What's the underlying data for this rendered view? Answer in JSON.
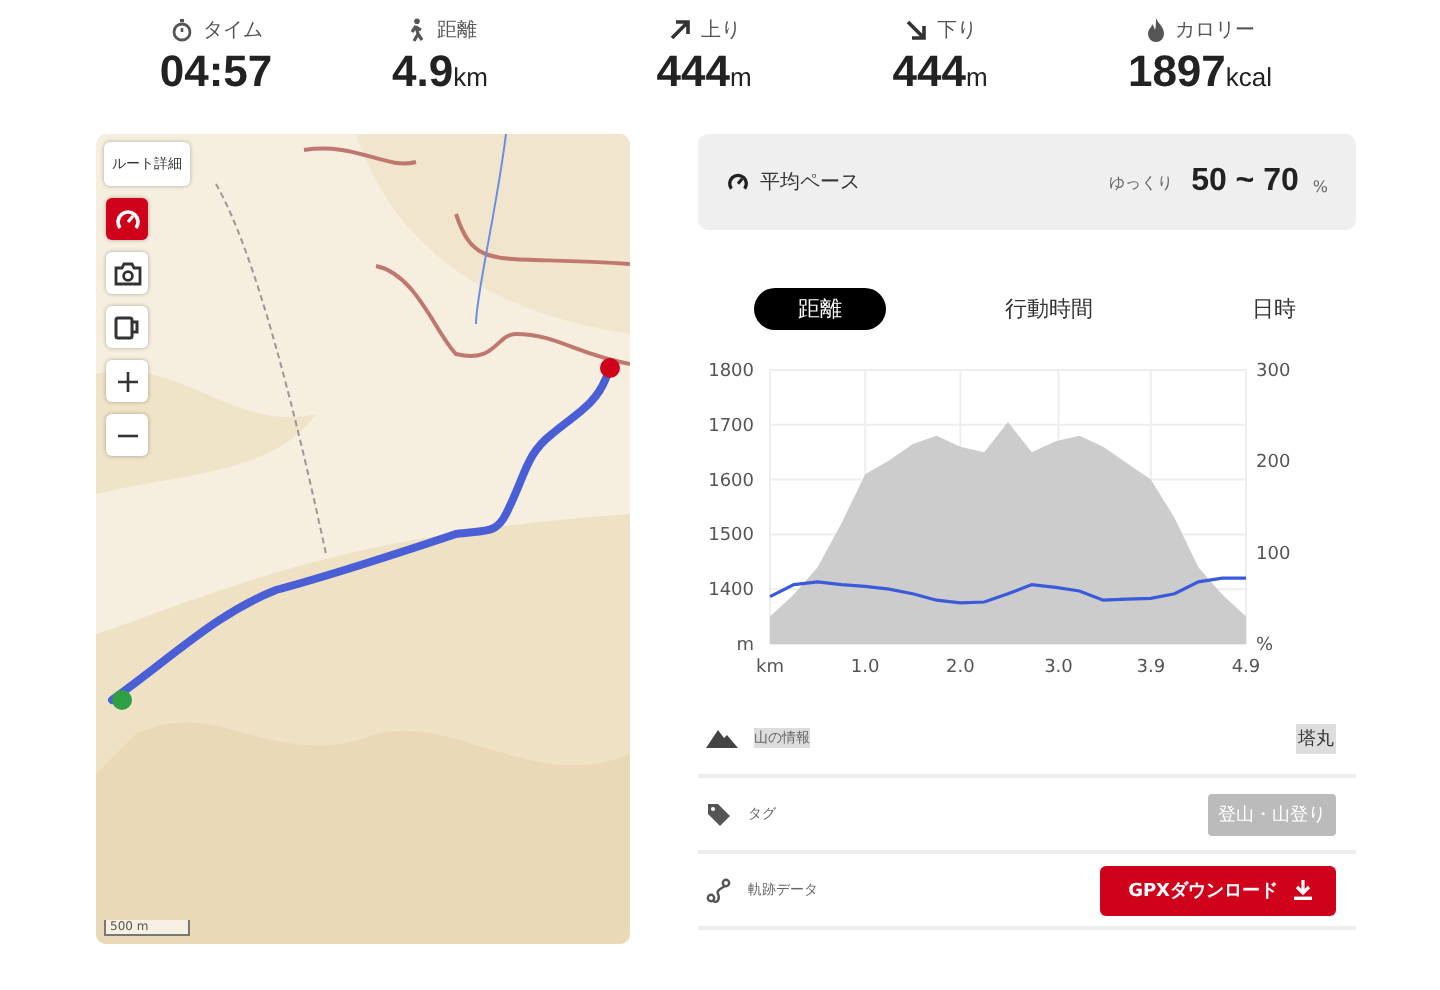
{
  "stats": [
    {
      "kind": "time",
      "label": "タイム",
      "value": "04:57"
    },
    {
      "kind": "distance",
      "label": "距離",
      "value": "4.9",
      "unit": "km"
    },
    {
      "kind": "up",
      "label": "上り",
      "value": "444",
      "unit": "m"
    },
    {
      "kind": "down",
      "label": "下り",
      "value": "444",
      "unit": "m"
    },
    {
      "kind": "calorie",
      "label": "カロリー",
      "value": "1897",
      "unit": "kcal"
    }
  ],
  "map": {
    "route_button": "ルート詳細",
    "scale": "500 m",
    "tools": [
      {
        "kind": "pace",
        "selected": true
      },
      {
        "kind": "camera",
        "selected": false
      },
      {
        "kind": "cup",
        "selected": false
      },
      {
        "kind": "zoom-in",
        "selected": false
      },
      {
        "kind": "zoom-out",
        "selected": false
      }
    ]
  },
  "pace": {
    "label": "平均ペース",
    "speed": "ゆっくり",
    "range": "50 ~ 70",
    "unit": "%"
  },
  "tabs": [
    {
      "label": "距離",
      "selected": true
    },
    {
      "label": "行動時間",
      "selected": false
    },
    {
      "label": "日時",
      "selected": false
    }
  ],
  "chart_data": {
    "type": "area",
    "x": [
      0,
      0.245,
      0.49,
      0.735,
      0.98,
      1.225,
      1.47,
      1.715,
      1.96,
      2.205,
      2.45,
      2.695,
      2.94,
      3.185,
      3.43,
      3.675,
      3.92,
      4.165,
      4.41,
      4.655,
      4.9
    ],
    "xlim": [
      0,
      4.9
    ],
    "grid": true,
    "xticks": [
      {
        "value": 0,
        "label": "km"
      },
      {
        "value": 0.98,
        "label": "1.0"
      },
      {
        "value": 1.96,
        "label": "2.0"
      },
      {
        "value": 2.97,
        "label": "3.0"
      },
      {
        "value": 3.92,
        "label": "3.9"
      },
      4.9
    ],
    "ylim": [
      1300,
      1800
    ],
    "yticks": [
      {
        "value": 1300,
        "label": "m"
      },
      1400,
      1500,
      1600,
      1700,
      1800
    ],
    "y2lim": [
      0,
      300
    ],
    "y2ticks": [
      {
        "value": 0,
        "label": "%"
      },
      100,
      200,
      300
    ],
    "series": [
      {
        "color": "#cccccc",
        "values": [
          1350,
          1390,
          1440,
          1520,
          1610,
          1635,
          1665,
          1680,
          1660,
          1650,
          1705,
          1650,
          1670,
          1680,
          1660,
          1630,
          1600,
          1530,
          1440,
          1390,
          1350
        ]
      },
      {
        "type": "line",
        "axis": "y2",
        "color": "#3a5bd9",
        "values": [
          52,
          65,
          68,
          65,
          63,
          60,
          55,
          48,
          45,
          46,
          55,
          65,
          62,
          58,
          48,
          49,
          50,
          55,
          68,
          72,
          72
        ]
      }
    ]
  },
  "rows": [
    {
      "kind": "mountain",
      "label": "山の情報",
      "value": "塔丸"
    },
    {
      "kind": "tag",
      "label": "タグ",
      "value": "登山・山登り"
    },
    {
      "kind": "track",
      "label": "軌跡データ",
      "value": "GPXダウンロード"
    }
  ]
}
